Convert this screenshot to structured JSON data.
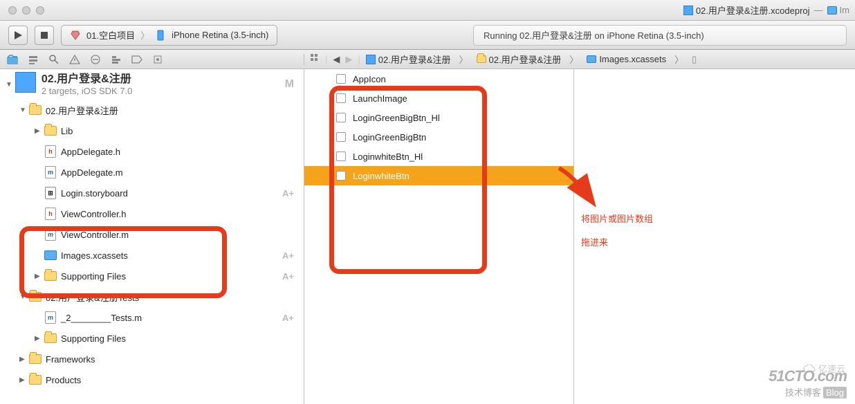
{
  "title_tabs": [
    {
      "label": "02.用户登录&注册.xcodeproj",
      "active": true
    },
    {
      "label": "— ",
      "dim": true
    },
    {
      "label": "Im",
      "icon": "xca",
      "dim": true
    }
  ],
  "scheme": {
    "project": "01.空白项目",
    "device": "iPhone Retina (3.5-inch)"
  },
  "status": "Running 02.用户登录&注册 on iPhone Retina (3.5-inch)",
  "jumpbar": [
    "02.用户登录&注册",
    "02.用户登录&注册",
    "Images.xcassets"
  ],
  "project": {
    "name": "02.用户登录&注册",
    "sub": "2 targets, iOS SDK 7.0",
    "mark": "M"
  },
  "tree": [
    {
      "ind": 1,
      "disc": "▼",
      "icon": "folder",
      "label": "02.用户登录&注册"
    },
    {
      "ind": 2,
      "disc": "▶",
      "icon": "folder",
      "label": "Lib"
    },
    {
      "ind": 2,
      "disc": "",
      "icon": "h",
      "label": "AppDelegate.h"
    },
    {
      "ind": 2,
      "disc": "",
      "icon": "m",
      "label": "AppDelegate.m"
    },
    {
      "ind": 2,
      "disc": "",
      "icon": "sb",
      "label": "Login.storyboard",
      "mark": "A+"
    },
    {
      "ind": 2,
      "disc": "",
      "icon": "h",
      "label": "ViewController.h"
    },
    {
      "ind": 2,
      "disc": "",
      "icon": "m",
      "label": "ViewController.m"
    },
    {
      "ind": 2,
      "disc": "",
      "icon": "xca",
      "label": "Images.xcassets",
      "mark": "A+"
    },
    {
      "ind": 2,
      "disc": "▶",
      "icon": "folder",
      "label": "Supporting Files",
      "mark": "A+"
    },
    {
      "ind": 1,
      "disc": "▼",
      "icon": "folder",
      "label": "02.用户登录&注册Tests"
    },
    {
      "ind": 2,
      "disc": "",
      "icon": "m",
      "label": "_2________Tests.m",
      "mark": "A+"
    },
    {
      "ind": 2,
      "disc": "▶",
      "icon": "folder",
      "label": "Supporting Files"
    },
    {
      "ind": 1,
      "disc": "▶",
      "icon": "folder",
      "label": "Frameworks"
    },
    {
      "ind": 1,
      "disc": "▶",
      "icon": "folder",
      "label": "Products"
    }
  ],
  "assets": [
    {
      "label": "AppIcon"
    },
    {
      "label": "LaunchImage"
    },
    {
      "label": "LoginGreenBigBtn_Hl"
    },
    {
      "label": "LoginGreenBigBtn"
    },
    {
      "label": "LoginwhiteBtn_Hl"
    },
    {
      "label": "LoginwhiteBtn",
      "selected": true
    }
  ],
  "annotation": {
    "line1": "将图片或图片数组",
    "line2": "拖进来"
  },
  "watermark": {
    "brand": "51CTO.com",
    "sub": "技术博客",
    "tag": "Blog",
    "cloud": "亿速云"
  }
}
